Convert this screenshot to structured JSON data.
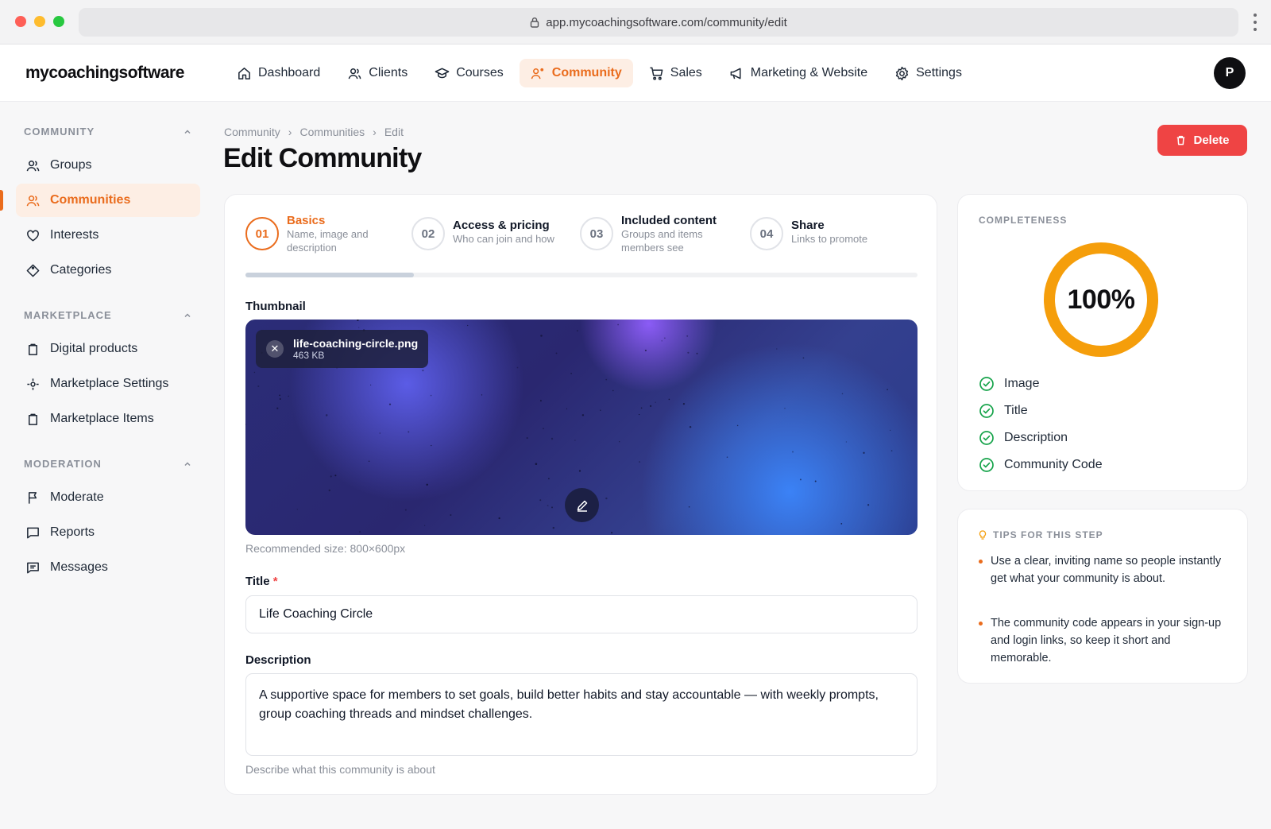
{
  "browser": {
    "url": "app.mycoachingsoftware.com/community/edit"
  },
  "app": {
    "logo": "mycoachingsoftware",
    "nav": [
      {
        "label": "Dashboard",
        "icon": "home-icon"
      },
      {
        "label": "Clients",
        "icon": "users-icon"
      },
      {
        "label": "Courses",
        "icon": "graduation-cap-icon"
      },
      {
        "label": "Community",
        "icon": "community-icon",
        "active": true
      },
      {
        "label": "Sales",
        "icon": "cart-icon"
      },
      {
        "label": "Marketing & Website",
        "icon": "megaphone-icon"
      },
      {
        "label": "Settings",
        "icon": "gear-icon"
      }
    ],
    "avatar_initial": "P"
  },
  "sidebar": {
    "sections": [
      {
        "title": "COMMUNITY",
        "items": [
          {
            "label": "Groups",
            "icon": "users-icon"
          },
          {
            "label": "Communities",
            "icon": "users-icon",
            "active": true
          },
          {
            "label": "Interests",
            "icon": "heart-icon"
          },
          {
            "label": "Categories",
            "icon": "tag-icon"
          }
        ]
      },
      {
        "title": "MARKETPLACE",
        "items": [
          {
            "label": "Digital products",
            "icon": "box-icon"
          },
          {
            "label": "Marketplace Settings",
            "icon": "settings-dot-icon"
          },
          {
            "label": "Marketplace Items",
            "icon": "box-icon"
          }
        ]
      },
      {
        "title": "MODERATION",
        "items": [
          {
            "label": "Moderate",
            "icon": "flag-icon"
          },
          {
            "label": "Reports",
            "icon": "message-square-icon"
          },
          {
            "label": "Messages",
            "icon": "message-lines-icon"
          }
        ]
      }
    ]
  },
  "page": {
    "breadcrumb": [
      "Community",
      "Communities",
      "Edit"
    ],
    "breadcrumb_sep": "›",
    "title": "Edit Community",
    "delete_label": "Delete"
  },
  "steps": [
    {
      "num": "01",
      "title": "Basics",
      "sub": "Name, image and description",
      "active": true
    },
    {
      "num": "02",
      "title": "Access & pricing",
      "sub": "Who can join and how"
    },
    {
      "num": "03",
      "title": "Included content",
      "sub": "Groups and items members see"
    },
    {
      "num": "04",
      "title": "Share",
      "sub": "Links to promote"
    }
  ],
  "step_progress": 0.25,
  "form": {
    "thumbnail_label": "Thumbnail",
    "file_name": "life-coaching-circle.png",
    "file_size": "463 KB",
    "thumbnail_hint": "Recommended size: 800×600px",
    "title_label": "Title",
    "title_required": "*",
    "title_value": "Life Coaching Circle",
    "description_label": "Description",
    "description_value": "A supportive space for members to set goals, build better habits and stay accountable — with weekly prompts, group coaching threads and mindset challenges.",
    "description_hint": "Describe what this community is about"
  },
  "completeness": {
    "caption": "COMPLETENESS",
    "value": 1.0,
    "label": "100%",
    "items": [
      "Image",
      "Title",
      "Description",
      "Community Code"
    ]
  },
  "tips": {
    "caption": "TIPS FOR THIS STEP",
    "items": [
      "Use a clear, inviting name so people instantly get what your community is about.",
      "The community code appears in your sign-up and login links, so keep it short and memorable."
    ]
  },
  "colors": {
    "accent": "#ea6c1d",
    "danger": "#ef4444",
    "success": "#16a34a",
    "ring": "#f59e0b"
  }
}
